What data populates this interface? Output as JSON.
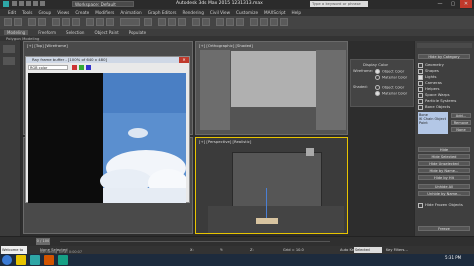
{
  "titlebar": {
    "workspace": "Workspace: Default",
    "title": "Autodesk 3ds Max 2015    1231313.max",
    "search": "Type a keyword or phrase",
    "min": "—",
    "max": "▢",
    "close": "✕"
  },
  "menubar": [
    "Edit",
    "Tools",
    "Group",
    "Views",
    "Create",
    "Modifiers",
    "Animation",
    "Graph Editors",
    "Rendering",
    "Civil View",
    "Customize",
    "MAXScript",
    "Help"
  ],
  "ribbon": {
    "tabs": [
      "Modeling",
      "Freeform",
      "Selection",
      "Object Paint",
      "Populate"
    ],
    "sub": "Polygon Modeling"
  },
  "viewports": {
    "top_left_label": "[+] [Top] [Wireframe]",
    "top_right_label": "[+] [Orthographic] [Shaded]",
    "bottom_right_label": "[+] [Perspective] [Realistic]"
  },
  "framebuffer": {
    "title": "Ray frame buffer - [100% of 640 x 480]",
    "channel": "RGB color"
  },
  "display_color": {
    "title": "Display Color",
    "wireframe": "Wireframe:",
    "shaded": "Shaded:",
    "options": [
      "Object Color",
      "Material Color"
    ]
  },
  "command_panel": {
    "hide_by_category": "Hide by Category",
    "categories": [
      "Geometry",
      "Shapes",
      "Lights",
      "Cameras",
      "Helpers",
      "Space Warps",
      "Particle Systems",
      "Bone Objects"
    ],
    "list_items": [
      "Bone",
      "IK Chain Object",
      "Point"
    ],
    "add": "Add...",
    "remove": "Remove",
    "none": "None",
    "hide": "Hide",
    "hide_buttons": [
      "Hide Selected",
      "Hide Unselected",
      "Hide by Name...",
      "Hide by Hit"
    ],
    "unhide_buttons": [
      "Unhide All",
      "Unhide by Name..."
    ],
    "hide_frozen": "Hide Frozen Objects",
    "freeze": "Freeze"
  },
  "timeline": {
    "frame": "0 / 100"
  },
  "status": {
    "selection": "None Selected",
    "render_time": "Rendering Time: 0:00:07",
    "coords": {
      "x": "X:",
      "y": "Y:",
      "z": "Z:"
    },
    "grid": "Grid = 10.0",
    "autokey": "Auto Key",
    "selected": "Selected",
    "setkey": "Set Key",
    "keyfilters": "Key Filters...",
    "welcome": "Welcome to M"
  },
  "taskbar": {
    "time": "5:31 PM"
  },
  "colors": {
    "accent": "#e8c400",
    "selected_fill": "#b3c7e6"
  }
}
